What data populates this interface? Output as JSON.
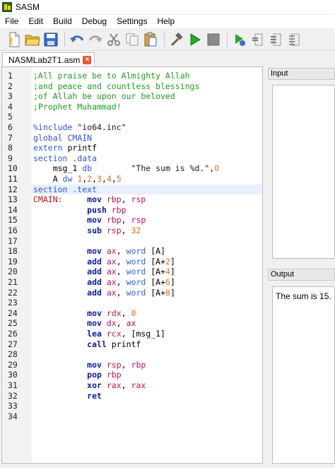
{
  "window": {
    "title": "SASM"
  },
  "menu": [
    "File",
    "Edit",
    "Build",
    "Debug",
    "Settings",
    "Help"
  ],
  "toolbar": {
    "buttons": [
      "new-file-icon",
      "open-folder-icon",
      "save-icon",
      "undo-icon",
      "redo-icon",
      "cut-icon",
      "copy-icon",
      "paste-icon",
      "build-hammer-icon",
      "run-icon",
      "stop-icon",
      "debug-icon",
      "step-into-icon",
      "step-over-icon",
      "step-out-icon"
    ]
  },
  "tab": {
    "label": "NASMLab2T1.asm",
    "close": "×"
  },
  "editor": {
    "line_numbers": [
      "1",
      "2",
      "3",
      "4",
      "5",
      "6",
      "7",
      "8",
      "9",
      "10",
      "11",
      "12",
      "13",
      "14",
      "15",
      "16",
      "17",
      "18",
      "19",
      "20",
      "21",
      "22",
      "23",
      "24",
      "25",
      "26",
      "27",
      "28",
      "29",
      "30",
      "31",
      "32",
      "33",
      "34"
    ],
    "highlighted_line": 12,
    "lines": [
      [
        {
          "t": ";All praise be to Almighty Allah",
          "c": "comment"
        }
      ],
      [
        {
          "t": ";and peace and countless blessings",
          "c": "comment"
        }
      ],
      [
        {
          "t": ";of Allah be upon our beloved",
          "c": "comment"
        }
      ],
      [
        {
          "t": ";Prophet Muhammad!",
          "c": "comment"
        }
      ],
      [],
      [
        {
          "t": "%include ",
          "c": "dir"
        },
        {
          "t": "\"io64.inc\"",
          "c": "str"
        }
      ],
      [
        {
          "t": "global ",
          "c": "dir"
        },
        {
          "t": "CMAIN",
          "c": "dir"
        }
      ],
      [
        {
          "t": "extern ",
          "c": "dir"
        },
        {
          "t": "printf",
          "c": "plain"
        }
      ],
      [
        {
          "t": "section .data",
          "c": "dir"
        }
      ],
      [
        {
          "t": "    msg_1 ",
          "c": "plain"
        },
        {
          "t": "db",
          "c": "size"
        },
        {
          "t": "        \"The sum is %d.\",",
          "c": "str"
        },
        {
          "t": "0",
          "c": "num"
        }
      ],
      [
        {
          "t": "    A ",
          "c": "plain"
        },
        {
          "t": "dw ",
          "c": "size"
        },
        {
          "t": "1",
          "c": "num"
        },
        {
          "t": ",",
          "c": "plain"
        },
        {
          "t": "2",
          "c": "num"
        },
        {
          "t": ",",
          "c": "plain"
        },
        {
          "t": "3",
          "c": "num"
        },
        {
          "t": ",",
          "c": "plain"
        },
        {
          "t": "4",
          "c": "num"
        },
        {
          "t": ",",
          "c": "plain"
        },
        {
          "t": "5",
          "c": "num"
        }
      ],
      [
        {
          "t": "section .text",
          "c": "dir"
        }
      ],
      [
        {
          "t": "CMAIN:",
          "c": "label"
        },
        {
          "t": "     ",
          "c": "plain"
        },
        {
          "t": "mov ",
          "c": "kw"
        },
        {
          "t": "rbp",
          "c": "reg"
        },
        {
          "t": ", ",
          "c": "plain"
        },
        {
          "t": "rsp",
          "c": "reg"
        }
      ],
      [
        {
          "t": "           ",
          "c": "plain"
        },
        {
          "t": "push ",
          "c": "kw"
        },
        {
          "t": "rbp",
          "c": "reg"
        }
      ],
      [
        {
          "t": "           ",
          "c": "plain"
        },
        {
          "t": "mov ",
          "c": "kw"
        },
        {
          "t": "rbp",
          "c": "reg"
        },
        {
          "t": ", ",
          "c": "plain"
        },
        {
          "t": "rsp",
          "c": "reg"
        }
      ],
      [
        {
          "t": "           ",
          "c": "plain"
        },
        {
          "t": "sub ",
          "c": "kw"
        },
        {
          "t": "rsp",
          "c": "reg"
        },
        {
          "t": ", ",
          "c": "plain"
        },
        {
          "t": "32",
          "c": "num"
        }
      ],
      [],
      [
        {
          "t": "           ",
          "c": "plain"
        },
        {
          "t": "mov ",
          "c": "kw"
        },
        {
          "t": "ax",
          "c": "reg"
        },
        {
          "t": ", ",
          "c": "plain"
        },
        {
          "t": "word ",
          "c": "size"
        },
        {
          "t": "[A]",
          "c": "mem"
        }
      ],
      [
        {
          "t": "           ",
          "c": "plain"
        },
        {
          "t": "add ",
          "c": "kw"
        },
        {
          "t": "ax",
          "c": "reg"
        },
        {
          "t": ", ",
          "c": "plain"
        },
        {
          "t": "word ",
          "c": "size"
        },
        {
          "t": "[A+",
          "c": "mem"
        },
        {
          "t": "2",
          "c": "num"
        },
        {
          "t": "]",
          "c": "mem"
        }
      ],
      [
        {
          "t": "           ",
          "c": "plain"
        },
        {
          "t": "add ",
          "c": "kw"
        },
        {
          "t": "ax",
          "c": "reg"
        },
        {
          "t": ", ",
          "c": "plain"
        },
        {
          "t": "word ",
          "c": "size"
        },
        {
          "t": "[A+",
          "c": "mem"
        },
        {
          "t": "4",
          "c": "num"
        },
        {
          "t": "]",
          "c": "mem"
        }
      ],
      [
        {
          "t": "           ",
          "c": "plain"
        },
        {
          "t": "add ",
          "c": "kw"
        },
        {
          "t": "ax",
          "c": "reg"
        },
        {
          "t": ", ",
          "c": "plain"
        },
        {
          "t": "word ",
          "c": "size"
        },
        {
          "t": "[A+",
          "c": "mem"
        },
        {
          "t": "6",
          "c": "num"
        },
        {
          "t": "]",
          "c": "mem"
        }
      ],
      [
        {
          "t": "           ",
          "c": "plain"
        },
        {
          "t": "add ",
          "c": "kw"
        },
        {
          "t": "ax",
          "c": "reg"
        },
        {
          "t": ", ",
          "c": "plain"
        },
        {
          "t": "word ",
          "c": "size"
        },
        {
          "t": "[A+",
          "c": "mem"
        },
        {
          "t": "8",
          "c": "num"
        },
        {
          "t": "]",
          "c": "mem"
        }
      ],
      [],
      [
        {
          "t": "           ",
          "c": "plain"
        },
        {
          "t": "mov ",
          "c": "kw"
        },
        {
          "t": "rdx",
          "c": "reg"
        },
        {
          "t": ", ",
          "c": "plain"
        },
        {
          "t": "0",
          "c": "num"
        }
      ],
      [
        {
          "t": "           ",
          "c": "plain"
        },
        {
          "t": "mov ",
          "c": "kw"
        },
        {
          "t": "dx",
          "c": "reg"
        },
        {
          "t": ", ",
          "c": "plain"
        },
        {
          "t": "ax",
          "c": "reg"
        }
      ],
      [
        {
          "t": "           ",
          "c": "plain"
        },
        {
          "t": "lea ",
          "c": "kw"
        },
        {
          "t": "rcx",
          "c": "reg"
        },
        {
          "t": ", ",
          "c": "plain"
        },
        {
          "t": "[msg_1]",
          "c": "mem"
        }
      ],
      [
        {
          "t": "           ",
          "c": "plain"
        },
        {
          "t": "call ",
          "c": "kw"
        },
        {
          "t": "printf",
          "c": "plain"
        }
      ],
      [],
      [
        {
          "t": "           ",
          "c": "plain"
        },
        {
          "t": "mov ",
          "c": "kw"
        },
        {
          "t": "rsp",
          "c": "reg"
        },
        {
          "t": ", ",
          "c": "plain"
        },
        {
          "t": "rbp",
          "c": "reg"
        }
      ],
      [
        {
          "t": "           ",
          "c": "plain"
        },
        {
          "t": "pop ",
          "c": "kw"
        },
        {
          "t": "rbp",
          "c": "reg"
        }
      ],
      [
        {
          "t": "           ",
          "c": "plain"
        },
        {
          "t": "xor ",
          "c": "kw"
        },
        {
          "t": "rax",
          "c": "reg"
        },
        {
          "t": ", ",
          "c": "plain"
        },
        {
          "t": "rax",
          "c": "reg"
        }
      ],
      [
        {
          "t": "           ",
          "c": "plain"
        },
        {
          "t": "ret",
          "c": "kw"
        }
      ],
      [],
      []
    ]
  },
  "input_panel": {
    "label": "Input"
  },
  "output_panel": {
    "label": "Output",
    "text": "The sum is 15."
  }
}
